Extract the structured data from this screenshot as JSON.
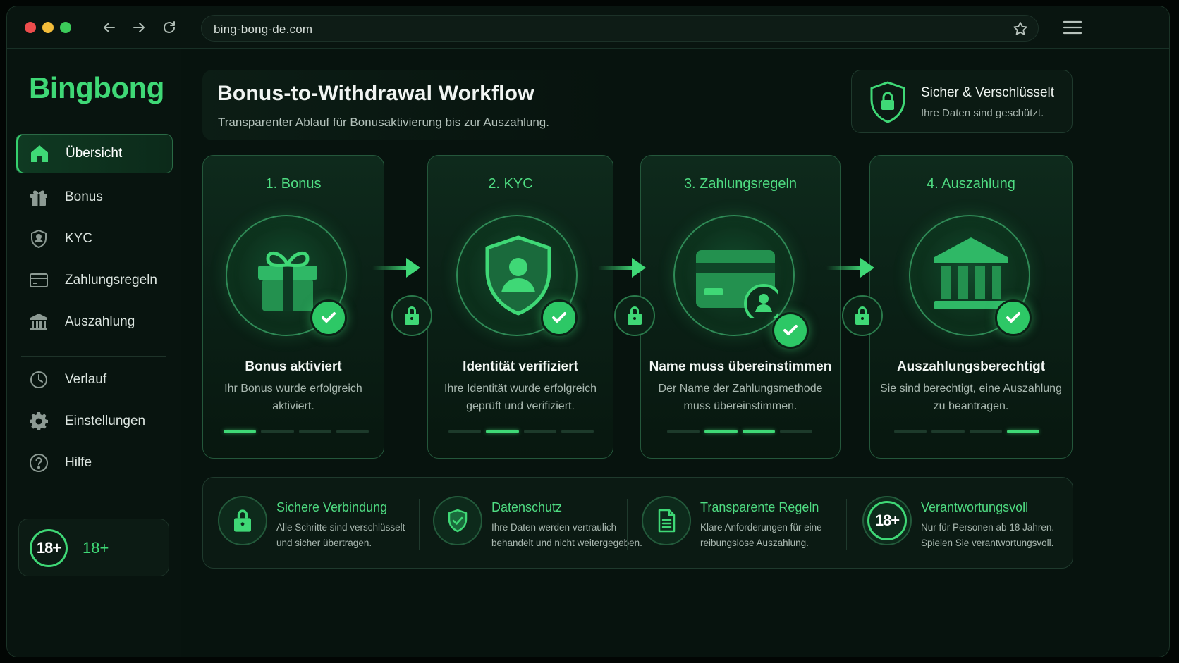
{
  "browser": {
    "url": "bing-bong-de.com",
    "back_icon": "arrow-left-icon",
    "forward_icon": "arrow-right-icon",
    "reload_icon": "reload-icon",
    "bookmark_icon": "star-icon",
    "menu_icon": "hamburger-menu-icon"
  },
  "sidebar": {
    "brand": "Bingbong",
    "items": [
      {
        "label": "Übersicht",
        "icon": "home-icon",
        "active": true
      },
      {
        "label": "Bonus",
        "icon": "gift-icon",
        "active": false
      },
      {
        "label": "KYC",
        "icon": "shield-user-icon",
        "active": false
      },
      {
        "label": "Zahlungsregeln",
        "icon": "credit-card-icon",
        "active": false
      },
      {
        "label": "Auszahlung",
        "icon": "bank-icon",
        "active": false
      },
      {
        "label": "Verlauf",
        "icon": "clock-icon",
        "active": false
      },
      {
        "label": "Einstellungen",
        "icon": "gear-icon",
        "active": false
      },
      {
        "label": "Hilfe",
        "icon": "help-circle-icon",
        "active": false
      }
    ],
    "age_badge": "18+",
    "age_label": "18+"
  },
  "header": {
    "title": "Bonus-to-Withdrawal Workflow",
    "subtitle": "Transparenter Ablauf für Bonusaktivierung bis zur Auszahlung."
  },
  "security": {
    "title": "Sicher & Verschlüsselt",
    "subtitle": "Ihre Daten sind geschützt.",
    "icon": "shield-lock-icon"
  },
  "steps": [
    {
      "title": "1. Bonus",
      "name": "Bonus aktiviert",
      "desc_line1": "Ihr Bonus wurde erfolgreich",
      "desc_line2": "aktiviert.",
      "icon": "gift-icon",
      "progress": [
        1,
        0,
        0,
        0
      ]
    },
    {
      "title": "2. KYC",
      "name": "Identität verifiziert",
      "desc_line1": "Ihre Identität wurde erfolgreich",
      "desc_line2": "geprüft und verifiziert.",
      "icon": "shield-user-icon",
      "progress": [
        0,
        1,
        0,
        0
      ]
    },
    {
      "title": "3. Zahlungsregeln",
      "name": "Name muss übereinstimmen",
      "desc_line1": "Der Name der Zahlungsmethode",
      "desc_line2": "muss übereinstimmen.",
      "icon": "credit-card-user-icon",
      "progress": [
        0,
        1,
        1,
        0
      ]
    },
    {
      "title": "4. Auszahlung",
      "name": "Auszahlungsberechtigt",
      "desc_line1": "Sie sind berechtigt, eine Auszahlung",
      "desc_line2": "zu beantragen.",
      "icon": "bank-icon",
      "progress": [
        0,
        0,
        0,
        1
      ]
    }
  ],
  "colors": {
    "accent": "#3fd876",
    "background": "#07130e",
    "card": "#0b1a13"
  },
  "features": [
    {
      "title": "Sichere Verbindung",
      "line1": "Alle Schritte sind verschlüsselt",
      "line2": "und sicher übertragen.",
      "icon": "lock-icon"
    },
    {
      "title": "Datenschutz",
      "line1": "Ihre Daten werden vertraulich",
      "line2": "behandelt und nicht weitergegeben.",
      "icon": "shield-check-icon"
    },
    {
      "title": "Transparente Regeln",
      "line1": "Klare Anforderungen für eine",
      "line2": "reibungslose Auszahlung.",
      "icon": "document-icon"
    },
    {
      "title": "Verantwortungsvoll",
      "line1": "Nur für Personen ab 18 Jahren.",
      "line2": "Spielen Sie verantwortungsvoll.",
      "icon": "age-18-icon",
      "badge": "18+"
    }
  ]
}
